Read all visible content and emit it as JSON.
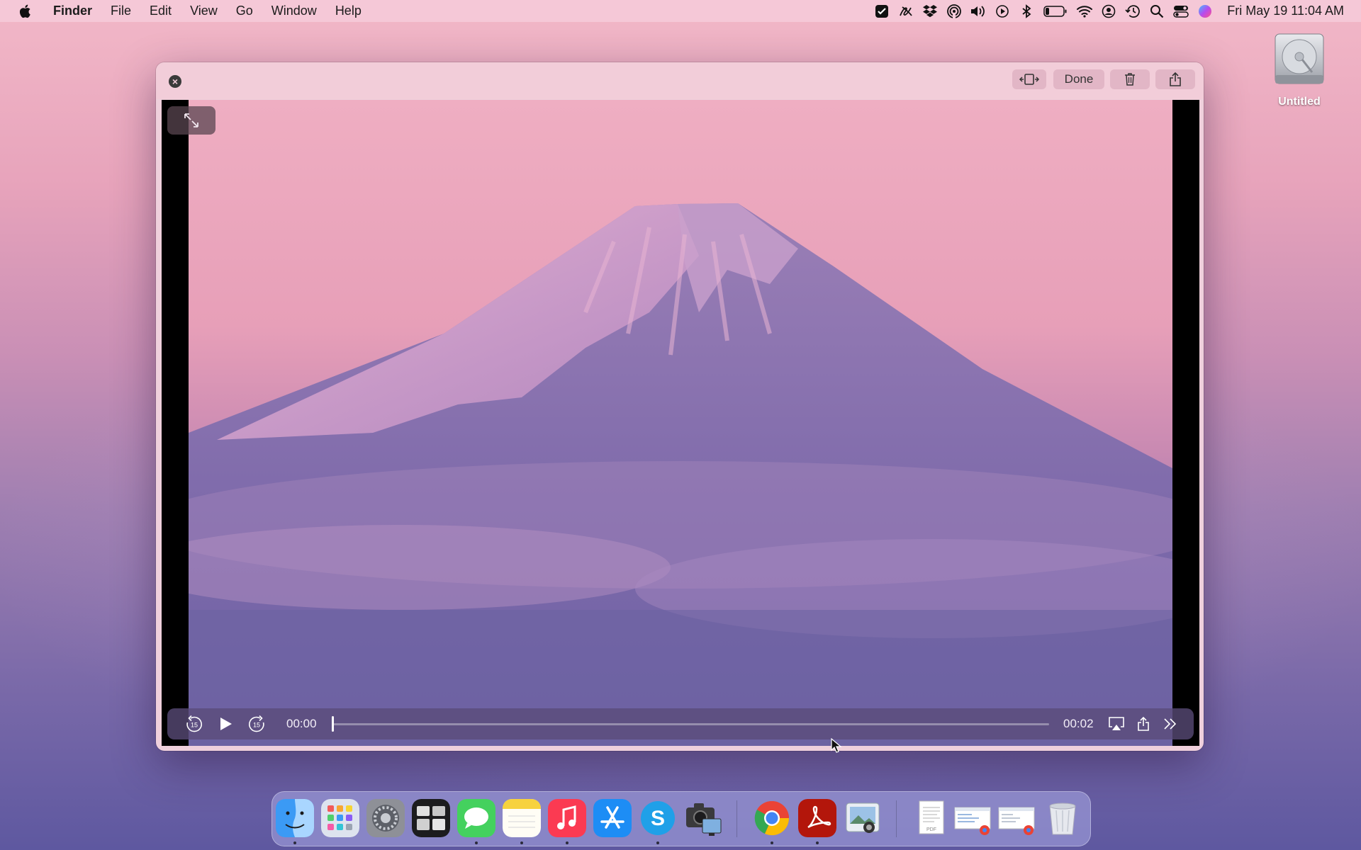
{
  "menubar": {
    "app_name": "Finder",
    "items": [
      "File",
      "Edit",
      "View",
      "Go",
      "Window",
      "Help"
    ],
    "clock": "Fri May 19  11:04 AM",
    "status_icons": [
      "checkbox-app-icon",
      "scribble-icon",
      "dropbox-icon",
      "airdrop-icon",
      "volume-icon",
      "play-icon",
      "bluetooth-icon",
      "battery-icon",
      "wifi-icon",
      "user-icon",
      "time-machine-icon",
      "search-icon",
      "control-center-icon",
      "siri-icon"
    ]
  },
  "desktop": {
    "disk_label": "Untitled"
  },
  "window": {
    "toolbar": {
      "done_label": "Done"
    },
    "player": {
      "current_time": "00:00",
      "duration": "00:02",
      "progress": 0.0,
      "skip_back_label": "15",
      "skip_forward_label": "15"
    }
  },
  "dock": {
    "apps": [
      "Finder",
      "Launchpad",
      "System Settings",
      "Mission Control",
      "Messages",
      "Notes",
      "Music",
      "App Store",
      "Skype",
      "Screenshot",
      "Google Chrome",
      "Adobe Acrobat",
      "Preview",
      "PDF Document",
      "Chrome Window",
      "Chrome Window",
      "Trash"
    ]
  },
  "colors": {
    "menubar_bg": "#f5cddc",
    "window_bg": "#efd0dc",
    "controls_bg": "#5a4b78"
  }
}
